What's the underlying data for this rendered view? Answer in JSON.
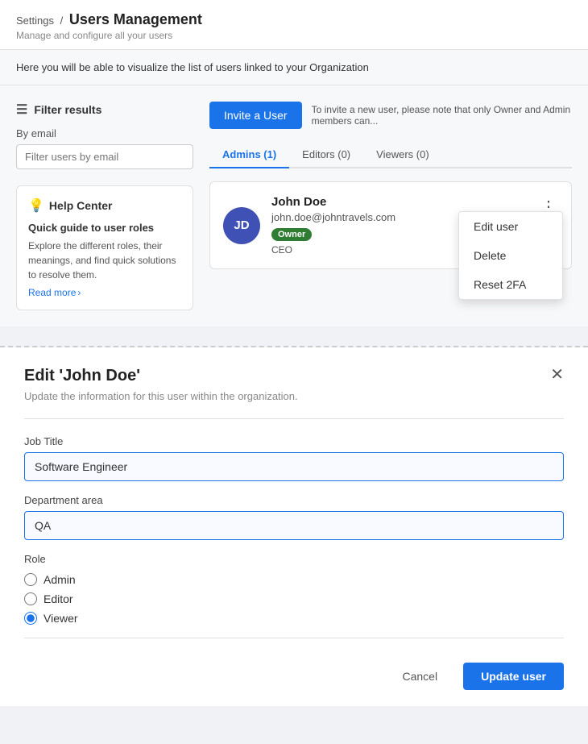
{
  "header": {
    "breadcrumb_settings": "Settings",
    "breadcrumb_separator": "/",
    "page_title": "Users Management",
    "subtitle": "Manage and configure all your users"
  },
  "info_bar": {
    "text": "Here you will be able to visualize the list of users linked to your Organization"
  },
  "sidebar": {
    "filter_label": "Filter results",
    "by_email_label": "By email",
    "email_placeholder": "Filter users by email",
    "help_center_title": "Help Center",
    "guide_title": "Quick guide to user roles",
    "guide_text": "Explore the different roles, their meanings, and find quick solutions to resolve them.",
    "read_more": "Read more"
  },
  "invite": {
    "button_label": "Invite a User",
    "note": "To invite a new user, please note that only Owner and Admin members can..."
  },
  "tabs": [
    {
      "label": "Admins (1)",
      "active": true
    },
    {
      "label": "Editors (0)",
      "active": false
    },
    {
      "label": "Viewers (0)",
      "active": false
    }
  ],
  "user_card": {
    "initials": "JD",
    "name": "John Doe",
    "email": "john.doe@johntravels.com",
    "role": "CEO",
    "badge": "Owner"
  },
  "context_menu": {
    "edit": "Edit user",
    "delete": "Delete",
    "reset": "Reset 2FA"
  },
  "edit_panel": {
    "title": "Edit 'John Doe'",
    "subtitle": "Update the information for this user within the organization.",
    "job_title_label": "Job Title",
    "job_title_value": "Software Engineer",
    "department_label": "Department area",
    "department_value": "QA",
    "role_label": "Role",
    "roles": [
      {
        "label": "Admin",
        "value": "admin",
        "checked": false
      },
      {
        "label": "Editor",
        "value": "editor",
        "checked": false
      },
      {
        "label": "Viewer",
        "value": "viewer",
        "checked": true
      }
    ],
    "cancel_label": "Cancel",
    "update_label": "Update user"
  },
  "colors": {
    "primary": "#1a73e8",
    "owner_badge": "#2e7d32",
    "avatar_bg": "#3f51b5"
  }
}
